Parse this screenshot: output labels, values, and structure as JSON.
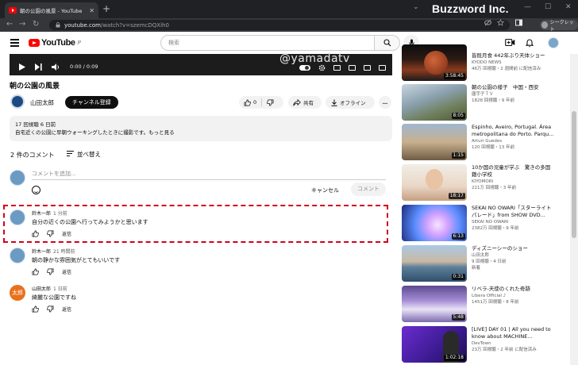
{
  "browser": {
    "tab_title": "朝の公園の風景 - YouTube",
    "tab_close": "✕",
    "new_tab": "+",
    "brand": "Buzzword Inc.",
    "url_host": "youtube.com",
    "url_path": "/watch?v=szemcDQXih0",
    "profile_label": "シークレット",
    "back": "←",
    "forward": "→",
    "reload": "↻",
    "minimize": "⌄",
    "maximize": "—",
    "restore": "☐",
    "close": "✕"
  },
  "youtube": {
    "logo_text": "YouTube",
    "logo_sup": "JP",
    "search_placeholder": "検索"
  },
  "player": {
    "time": "0:00 / 0:09",
    "watermark": "@yamadatv"
  },
  "video": {
    "title": "朝の公園の風景",
    "channel": "山田太郎",
    "subscribe": "チャンネル登録",
    "likes": "0",
    "share": "共有",
    "offline": "オフライン",
    "more": "…",
    "views": "17 回視聴  6 日前",
    "description": "自宅近くの公園に早朝ウォーキングしたときに撮影です。もっと見る"
  },
  "comments": {
    "count": "2 件のコメント",
    "sort": "並べ替え",
    "add_placeholder": "コメントを追加...",
    "cancel": "キャンセル",
    "submit": "コメント",
    "items": [
      {
        "author": "鈴木一郎",
        "time": "1 分前",
        "text": "自分の近くの公園へ行ってみようかと思います",
        "reply": "返信"
      },
      {
        "author": "鈴木一郎",
        "time": "21 時間前",
        "text": "朝の静かな雰囲気がとてもいいです",
        "reply": "返信"
      },
      {
        "author": "山田太郎",
        "time": "1 日前",
        "text": "綺麗な公園ですね",
        "reply": "返信",
        "avatar_text": "太郎"
      }
    ]
  },
  "recommendations": [
    {
      "title": "皆既月食 442年ぶり天体ショー",
      "channel": "KYODO NEWS",
      "stats": "46万 回視聴・2 週間前 に配信済み",
      "duration": "3:58:45"
    },
    {
      "title": "朝の公園の様子　中国・西安",
      "channel": "唐宇子ＴＶ",
      "stats": "1828 回視聴・9 年前",
      "duration": "8:05"
    },
    {
      "title": "Espinho, Aveiro, Portugal. Área metropolitana do Porto. Parqu...",
      "channel": "Arturi Guedes",
      "stats": "120 回視聴・13 年前",
      "duration": "1:15"
    },
    {
      "title": "10か国の児童が学ぶ　驚きの多国籍小学校",
      "channel": "KIYOMORI",
      "stats": "221万 回視聴・3 年前",
      "duration": "18:17"
    },
    {
      "title": "SEKAI NO OWARI「スターライトパレード」from SHOW DVD...",
      "channel": "SEKAI NO OWARI",
      "stats": "2382万 回視聴・9 年前",
      "duration": "6:13"
    },
    {
      "title": "ディズニーシーのショー",
      "channel": "山田太郎",
      "stats": "9 回視聴・4 日前",
      "badge": "新着",
      "duration": "0:31"
    },
    {
      "title": "リベラ-天使のくれた奇跡",
      "channel": "Libera Official ♪",
      "stats": "1451万 回視聴・8 年前",
      "duration": "5:48"
    },
    {
      "title": "[LIVE] DAY 01 | All you need to know about MACHINE...",
      "channel": "DevTown",
      "stats": "23万 回視聴・2 年前 に配信済み",
      "duration": "1:02:18"
    }
  ]
}
